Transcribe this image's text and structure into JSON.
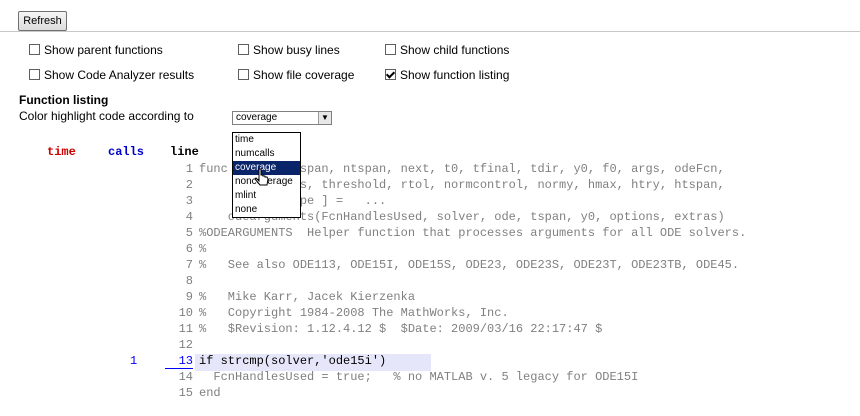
{
  "toolbar": {
    "refresh_label": "Refresh"
  },
  "options": {
    "row1": [
      {
        "label": "Show parent functions",
        "checked": false
      },
      {
        "label": "Show busy lines",
        "checked": false
      },
      {
        "label": "Show child functions",
        "checked": false
      }
    ],
    "row2": [
      {
        "label": "Show Code Analyzer results",
        "checked": false
      },
      {
        "label": "Show file coverage",
        "checked": false
      },
      {
        "label": "Show function listing",
        "checked": true
      }
    ]
  },
  "listing": {
    "heading": "Function listing",
    "color_label": "Color highlight code according to",
    "select_value": "coverage",
    "dropdown_options": [
      "time",
      "numcalls",
      "coverage",
      "noncoverage",
      "mlint",
      "none"
    ],
    "selected_option": "coverage"
  },
  "columns": {
    "time": "time",
    "calls": "calls",
    "line": "line"
  },
  "code": [
    {
      "num": "1",
      "text": "func          span, ntspan, next, t0, tfinal, tdir, y0, f0, args, odeFcn,"
    },
    {
      "num": "2",
      "text": "              s, threshold, rtol, normcontrol, normy, hmax, htry, htspan,"
    },
    {
      "num": "3",
      "text": "              pe ] =   ..."
    },
    {
      "num": "4",
      "text": "    odearguments(FcnHandlesUsed, solver, ode, tspan, y0, options, extras)"
    },
    {
      "num": "5",
      "text": "%ODEARGUMENTS  Helper function that processes arguments for all ODE solvers."
    },
    {
      "num": "6",
      "text": "%"
    },
    {
      "num": "7",
      "text": "%   See also ODE113, ODE15I, ODE15S, ODE23, ODE23S, ODE23T, ODE23TB, ODE45."
    },
    {
      "num": "8",
      "text": ""
    },
    {
      "num": "9",
      "text": "%   Mike Karr, Jacek Kierzenka"
    },
    {
      "num": "10",
      "text": "%   Copyright 1984-2008 The MathWorks, Inc."
    },
    {
      "num": "11",
      "text": "%   $Revision: 1.12.4.12 $  $Date: 2009/03/16 22:17:47 $"
    },
    {
      "num": "12",
      "text": ""
    },
    {
      "num": "13",
      "text": "if strcmp(solver,'ode15i')",
      "calls": "1",
      "executed": true
    },
    {
      "num": "14",
      "text": "  FcnHandlesUsed = true;   % no MATLAB v. 5 legacy for ODE15I"
    },
    {
      "num": "15",
      "text": "end"
    }
  ],
  "colors": {
    "time_header": "#cc0000",
    "calls_header": "#0000cc",
    "selection": "#0a246a",
    "highlight": "#e6e6fa"
  },
  "icons": {
    "cursor": "pointer-cursor-icon"
  }
}
